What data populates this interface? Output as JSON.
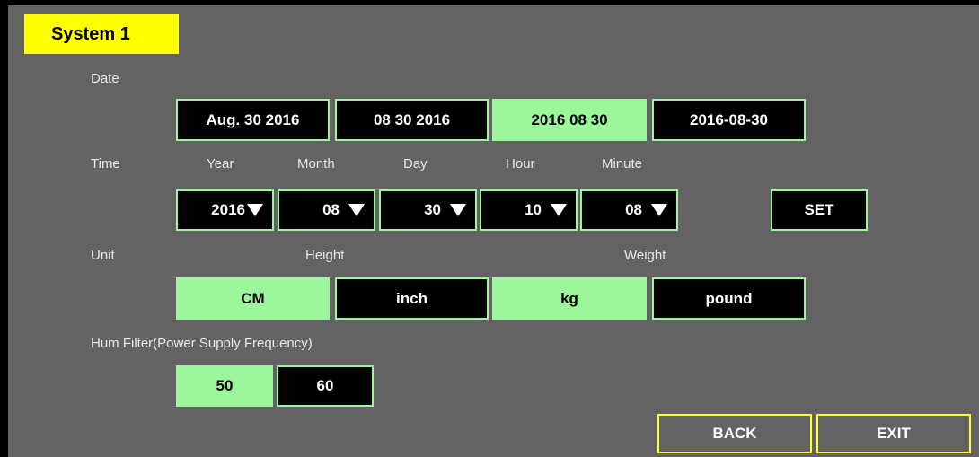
{
  "title": "System 1",
  "date": {
    "label": "Date",
    "formats": [
      "Aug. 30 2016",
      "08 30 2016",
      "2016 08 30",
      "2016-08-30"
    ],
    "selected": "2016 08 30"
  },
  "time": {
    "label": "Time",
    "headers": [
      "Year",
      "Month",
      "Day",
      "Hour",
      "Minute"
    ],
    "values": [
      "2016",
      "08",
      "30",
      "10",
      "08"
    ],
    "set_label": "SET"
  },
  "unit": {
    "label": "Unit",
    "height_label": "Height",
    "weight_label": "Weight",
    "height_options": [
      "CM",
      "inch"
    ],
    "height_selected": "CM",
    "weight_options": [
      "kg",
      "pound"
    ],
    "weight_selected": "kg"
  },
  "hum_filter": {
    "label": "Hum Filter(Power Supply Frequency)",
    "options": [
      "50",
      "60"
    ],
    "selected": "50"
  },
  "footer": {
    "back_label": "BACK",
    "exit_label": "EXIT"
  },
  "colors": {
    "accent_green": "#9cf79c",
    "title_yellow": "#ffff00",
    "background": "#636363"
  }
}
